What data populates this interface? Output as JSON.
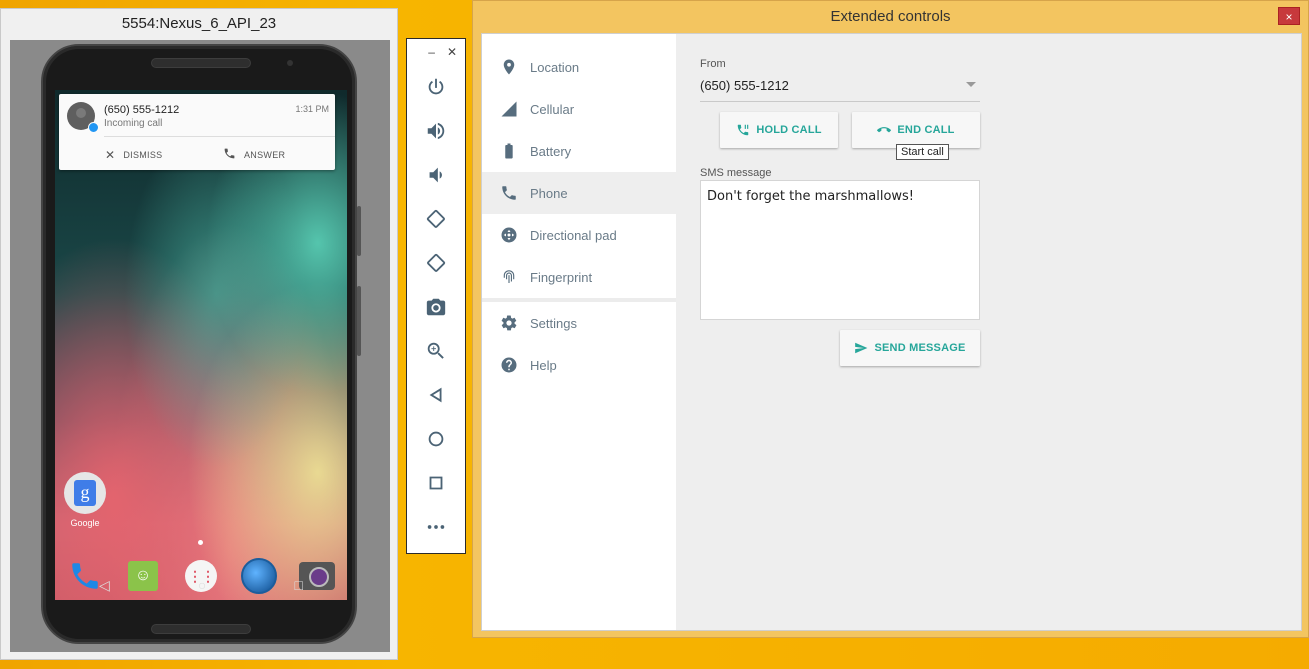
{
  "emulator": {
    "title": "5554:Nexus_6_API_23",
    "notification": {
      "caller": "(650) 555-1212",
      "subtitle": "Incoming call",
      "time": "1:31 PM",
      "dismiss_label": "DISMISS",
      "answer_label": "ANSWER"
    },
    "home_app_label": "Google",
    "dock_icons": [
      "phone-icon",
      "hangouts-icon",
      "apps-icon",
      "browser-icon",
      "camera-icon"
    ]
  },
  "toolbar": {
    "minimize": "–",
    "close": "✕",
    "buttons": [
      "power",
      "volume-up",
      "volume-down",
      "rotate-left",
      "rotate-right",
      "screenshot",
      "zoom",
      "back",
      "home",
      "overview",
      "more"
    ]
  },
  "extended": {
    "title": "Extended controls",
    "close": "×",
    "nav": [
      {
        "label": "Location",
        "icon": "location-icon"
      },
      {
        "label": "Cellular",
        "icon": "cellular-icon"
      },
      {
        "label": "Battery",
        "icon": "battery-icon"
      },
      {
        "label": "Phone",
        "icon": "phone-icon"
      },
      {
        "label": "Directional pad",
        "icon": "dpad-icon"
      },
      {
        "label": "Fingerprint",
        "icon": "fingerprint-icon"
      },
      {
        "label": "Settings",
        "icon": "settings-icon"
      },
      {
        "label": "Help",
        "icon": "help-icon"
      }
    ],
    "active_nav": "Phone",
    "phone": {
      "from_label": "From",
      "from_value": "(650) 555-1212",
      "hold_call_label": "HOLD CALL",
      "end_call_label": "END CALL",
      "tooltip": "Start call",
      "sms_label": "SMS message",
      "sms_value": "Don't forget the marshmallows!",
      "send_label": "SEND MESSAGE"
    },
    "accent_color": "#26a69a"
  }
}
